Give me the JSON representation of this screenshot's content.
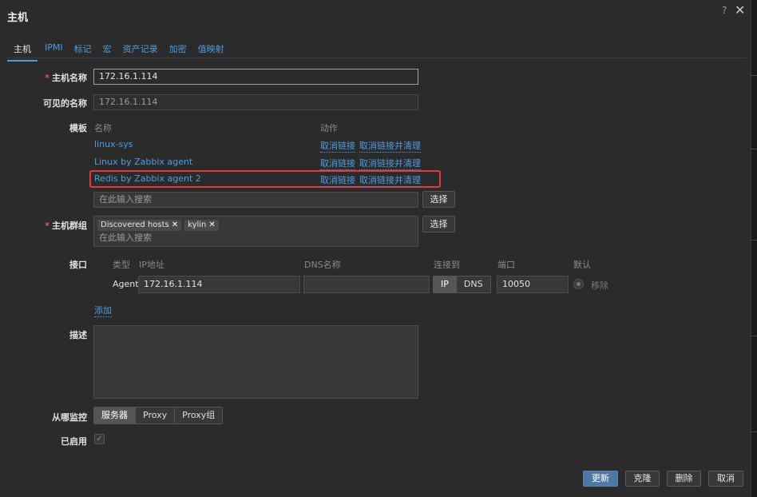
{
  "dialog": {
    "title": "主机",
    "help": "?",
    "close": "✕"
  },
  "tabs": [
    "主机",
    "IPMI",
    "标记",
    "宏",
    "资产记录",
    "加密",
    "值映射"
  ],
  "host_name": {
    "label": "主机名称",
    "value": "172.16.1.114"
  },
  "visible_name": {
    "label": "可见的名称",
    "placeholder": "172.16.1.114"
  },
  "templates": {
    "label": "模板",
    "col_name": "名称",
    "col_action": "动作",
    "rows": [
      {
        "name": "linux-sys",
        "unlink": "取消链接",
        "unlink_clear": "取消链接并清理"
      },
      {
        "name": "Linux by Zabbix agent",
        "unlink": "取消链接",
        "unlink_clear": "取消链接并清理"
      },
      {
        "name": "Redis by Zabbix agent 2",
        "unlink": "取消链接",
        "unlink_clear": "取消链接并清理"
      }
    ],
    "search_placeholder": "在此输入搜索",
    "select_label": "选择"
  },
  "host_groups": {
    "label": "主机群组",
    "tags": [
      "Discovered hosts",
      "kylin"
    ],
    "search_placeholder": "在此输入搜索",
    "select_label": "选择"
  },
  "interfaces": {
    "label": "接口",
    "col_type": "类型",
    "col_ip": "IP地址",
    "col_dns": "DNS名称",
    "col_connect": "连接到",
    "col_port": "端口",
    "col_default": "默认",
    "row": {
      "type": "Agent",
      "ip": "172.16.1.114",
      "dns": "",
      "connect_ip": "IP",
      "connect_dns": "DNS",
      "port": "10050",
      "remove": "移除"
    },
    "add": "添加"
  },
  "description": {
    "label": "描述",
    "value": ""
  },
  "monitored_by": {
    "label": "从哪监控",
    "options": [
      "服务器",
      "Proxy",
      "Proxy组"
    ]
  },
  "enabled": {
    "label": "已启用",
    "checked": true
  },
  "footer": {
    "update": "更新",
    "clone": "克隆",
    "delete": "删除",
    "cancel": "取消"
  },
  "colors": {
    "accent": "#4f9be0",
    "highlight": "#e33b3b",
    "primary_button": "#4f78a6"
  }
}
